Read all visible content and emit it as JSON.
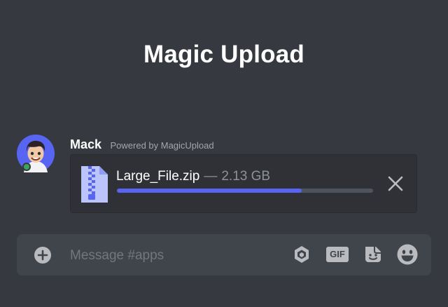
{
  "header": {
    "title": "Magic Upload"
  },
  "message": {
    "author": "Mack",
    "powered_by": "Powered by MagicUpload",
    "upload": {
      "file_name": "Large_File.zip",
      "separator": "—",
      "file_size": "2.13 GB",
      "progress": 0.72
    }
  },
  "composer": {
    "placeholder": "Message #apps",
    "gif_label": "GIF"
  },
  "colors": {
    "background": "#36393f",
    "card": "#2f3136",
    "composer": "#40444b",
    "accent": "#5865f2",
    "zip_icon": "#bcc5fb"
  },
  "icons": {
    "add": "add-circle-icon",
    "close": "close-icon",
    "file": "zip-file-icon",
    "gift": "gift-icon",
    "gif": "gif-icon",
    "sticker": "sticker-icon",
    "emoji": "emoji-icon"
  }
}
